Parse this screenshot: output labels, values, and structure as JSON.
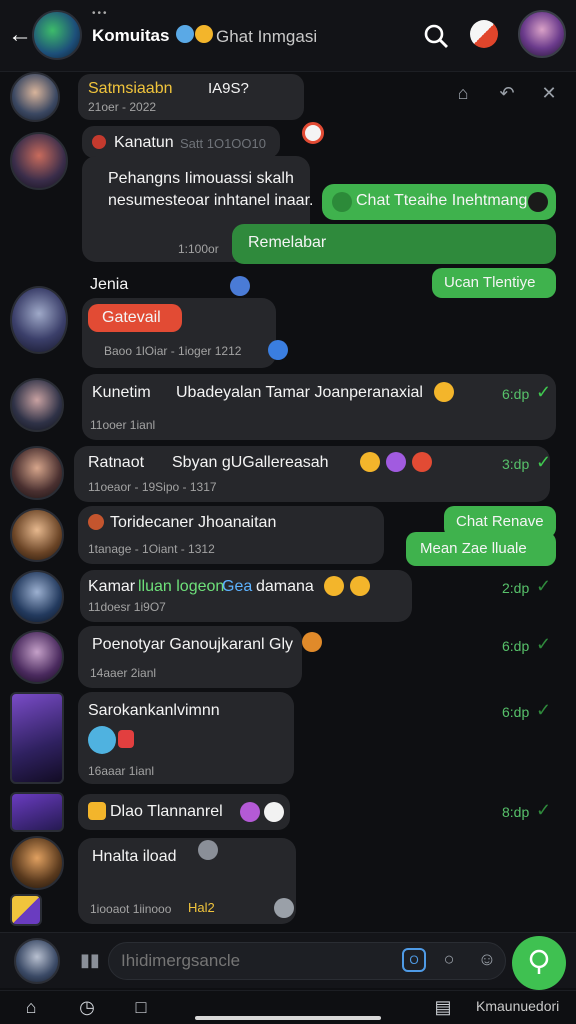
{
  "header": {
    "title": "Komuitas",
    "subtitle": "Ghat Inmgasi",
    "back_icon": "back-arrow-icon",
    "search_icon": "search-icon"
  },
  "pinned": {
    "name": "Satmsiaabn",
    "extra": "IA9S?",
    "date": "21oer - 2022"
  },
  "messages": [
    {
      "sender": "Kanatun",
      "sender_tag": "Satt 1O1OO10",
      "text1": "Pehangns Iimouassi skalh",
      "text2": "nesumesteoar inhtanel inaar.",
      "meta": "1:100or"
    },
    {
      "text": "Chat Tteaihe Inehtmang",
      "outgoing": true
    },
    {
      "text": "Remelabar",
      "outgoing": true
    },
    {
      "text": "Ucan Tlentiye",
      "outgoing": true
    },
    {
      "sender": "Jenia",
      "text": "Gatevail",
      "meta": "Baoo 1lOiar - 1ioger 1212"
    },
    {
      "text": "Kunetim",
      "text_b": "Ubadeyalan Tamar Joanperanaxial",
      "meta": "11ooer 1ianl",
      "time": "6:dp"
    },
    {
      "text": "Ratnaot",
      "text_b": "Sbyan gUGallereasah",
      "meta": "11oeaor - 19Sipo - 1317",
      "time": "3:dp"
    },
    {
      "text": "Toridecaner Jhoanaitan",
      "meta": "1tanage - 1Oiant - 1312"
    },
    {
      "text": "Chat Renave",
      "text_b": "Mean Zae lluale",
      "outgoing": true
    },
    {
      "text": "Kamar",
      "hl": "lluan logeon",
      "hl2": "Gea",
      "text_b": "damana",
      "meta": "11doesr 1i9O7",
      "time": "2:dp"
    },
    {
      "text": "Poenotyar Ganoujkaranl Gly",
      "meta": "14aaer 2ianl",
      "time": "6:dp"
    },
    {
      "text": "Sarokankanlvimnn",
      "meta": "16aaar 1ianl",
      "time": "6:dp"
    },
    {
      "text": "Dlao Tlannanrel",
      "time": "8:dp"
    },
    {
      "text": "Hnalta iload",
      "meta": "1iooaot 1iinooo",
      "meta_tag": "Hal2"
    }
  ],
  "input": {
    "placeholder": "Ihidimergsancle"
  },
  "tabs": {
    "last_label": "Kmaunuedori"
  }
}
